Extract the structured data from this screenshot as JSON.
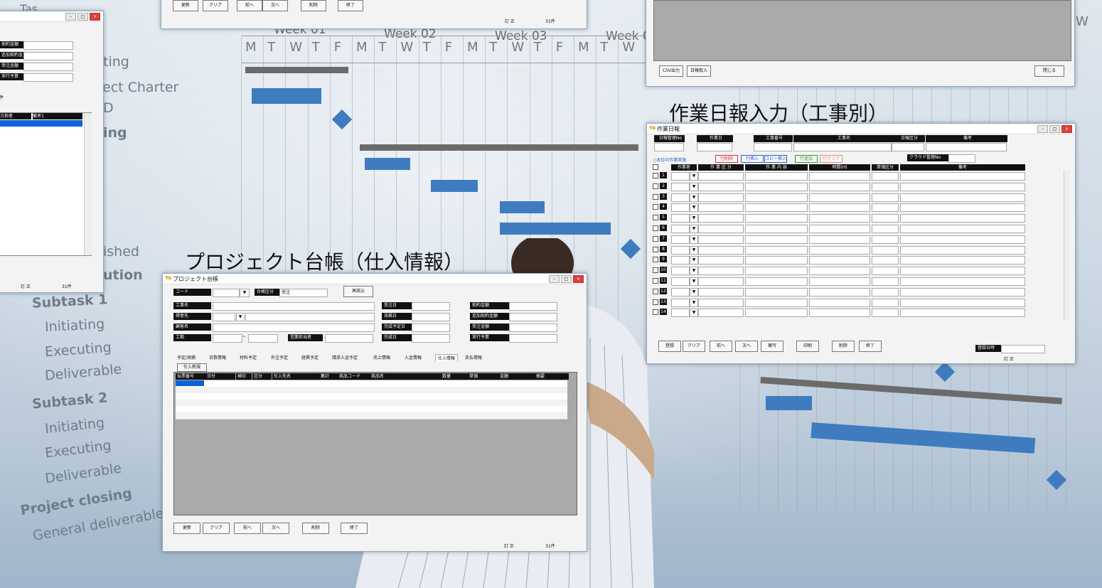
{
  "gantt": {
    "weeks": [
      "Week 01",
      "Week 02",
      "Week 03",
      "Week 0"
    ],
    "days": [
      "M",
      "T",
      "W",
      "T",
      "F",
      "M",
      "T",
      "W",
      "T",
      "F",
      "M",
      "T",
      "W",
      "T",
      "F",
      "M",
      "T",
      "W"
    ],
    "right_day": "W",
    "left_text": {
      "ting": "ting",
      "charter": "ect Charter",
      "d": "D",
      "ing": "ing",
      "ished": "ished",
      "ution": "ution",
      "subtask1": "Subtask 1",
      "initiating1": "Initiating",
      "executing1": "Executing",
      "deliverable1": "Deliverable",
      "subtask2": "Subtask 2",
      "initiating2": "Initiating",
      "executing2": "Executing",
      "deliverable2": "Deliverable",
      "closing": "Project closing",
      "general": "General deliverable"
    },
    "top_left_text": "Tas"
  },
  "headings": {
    "ledger": "プロジェクト台帳（仕入情報）",
    "daily": "作業日報入力（工事別）"
  },
  "left_window": {
    "labels": [
      "契約金額",
      "追加契約金額",
      "受注金額",
      "実行予算"
    ],
    "label_short": "件",
    "grid_headers": [
      "方担者",
      "備考1"
    ],
    "status_left": "訂 正",
    "status_right": "31件"
  },
  "top_window": {
    "buttons": [
      "更新",
      "クリア",
      "前へ",
      "次へ",
      "削除",
      "終了"
    ],
    "status_left": "訂 正",
    "status_right": "31件"
  },
  "top_right_window": {
    "buttons_left": [
      "CSV出力",
      "日報取入"
    ],
    "button_right": "閉じる"
  },
  "ledger_window": {
    "logo": "Ya",
    "title": "プロジェクト台帳",
    "code_label": "コード",
    "type_label": "台帳区分",
    "type_value": "受注",
    "reload": "再読込",
    "left_labels": [
      "工事名",
      "得意先",
      "顧客名",
      "工期"
    ],
    "sales_label": "営業担当者",
    "mid_labels": [
      "受注日",
      "見積日",
      "完成予定日",
      "完成日"
    ],
    "right_labels": [
      "契約金額",
      "追加契約金額",
      "受注金額",
      "実行予算"
    ],
    "tabs": [
      "予定/実績",
      "日数情報",
      "材料予定",
      "外注予定",
      "経費予定",
      "請求入金予定",
      "売上情報",
      "入金情報",
      "仕入情報",
      "支払情報"
    ],
    "active_tab": "仕入情報",
    "new_purchase": "仕入新規",
    "grid_headers": [
      "伝票番号",
      "日付",
      "検印",
      "区分",
      "仕入先名",
      "集計",
      "商品コード",
      "商品名",
      "数量",
      "単価",
      "金額",
      "摘要"
    ],
    "buttons": [
      "更新",
      "クリア",
      "前へ",
      "次へ",
      "削除",
      "終了"
    ],
    "status_left": "訂 正",
    "status_right": "31件"
  },
  "daily_window": {
    "logo": "Ya",
    "title": "作業日報",
    "header_labels": [
      "日報管理No",
      "作業日",
      "工事番号",
      "工事名",
      "日報区分",
      "備考"
    ],
    "section": "○本日の作業実施",
    "actions": [
      "行削除",
      "行挿入",
      "コピー挿入",
      "行追加",
      "行クリア"
    ],
    "cloud_label": "クラウド管理No",
    "grid_headers": [
      "作業者",
      "作 業 区 分",
      "作 業 内 容",
      "時間(H)",
      "単価区分",
      "備考"
    ],
    "row_numbers": [
      "1",
      "2",
      "3",
      "4",
      "5",
      "6",
      "7",
      "8",
      "9",
      "10",
      "11",
      "12",
      "13",
      "14"
    ],
    "buttons": [
      "登録",
      "クリア",
      "前へ",
      "次へ",
      "複写",
      "印刷",
      "削除",
      "終了"
    ],
    "reg_label": "登録日時",
    "status": "訂 正"
  },
  "colors": {
    "bar": "#3e7cbf",
    "summary": "#6b6b6b"
  }
}
